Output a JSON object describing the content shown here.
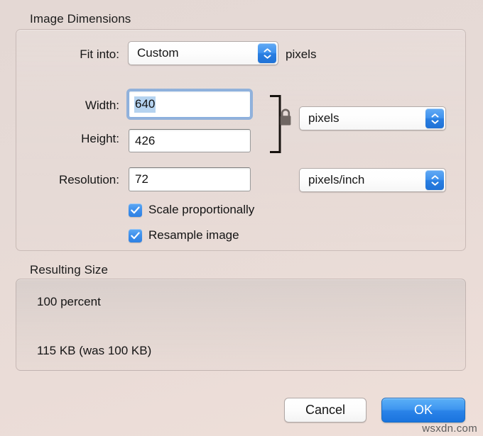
{
  "dialog": {
    "sections": {
      "image_dimensions": {
        "title": "Image Dimensions",
        "fit_into": {
          "label": "Fit into:",
          "value": "Custom",
          "unit_suffix": "pixels"
        },
        "width": {
          "label": "Width:",
          "value": "640",
          "selected": true
        },
        "height": {
          "label": "Height:",
          "value": "426"
        },
        "dimension_units": {
          "value": "pixels"
        },
        "resolution": {
          "label": "Resolution:",
          "value": "72"
        },
        "resolution_units": {
          "value": "pixels/inch"
        },
        "link_icon": "lock-closed-icon",
        "checkboxes": [
          {
            "label": "Scale proportionally",
            "checked": true
          },
          {
            "label": "Resample image",
            "checked": true
          }
        ]
      },
      "resulting_size": {
        "title": "Resulting Size",
        "percent_line": "100 percent",
        "size_line": "115 KB (was 100 KB)"
      }
    },
    "buttons": {
      "cancel": "Cancel",
      "ok": "OK"
    }
  },
  "watermark": "wsxdn.com",
  "colors": {
    "accent_blue": "#2a83e8",
    "selection_blue": "#b5d3f0",
    "background": "#e6dad6",
    "lock_gray": "#6f6662"
  }
}
